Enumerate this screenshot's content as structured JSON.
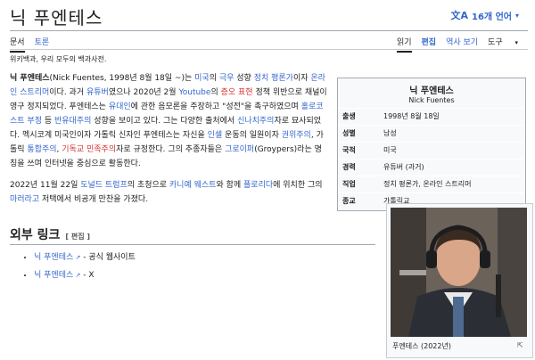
{
  "page": {
    "title": "닉 푸엔테스",
    "lang_button": "16개 언어",
    "lang_icon": "文A",
    "tagline": "위키백과, 우리 모두의 백과사전."
  },
  "tabs_left": [
    "문서",
    "토론"
  ],
  "tabs_right": [
    "읽기",
    "편집",
    "역사 보기",
    "도구"
  ],
  "lead": {
    "p1": [
      {
        "t": "닉 푸엔테스",
        "b": true
      },
      {
        "t": "(Nick Fuentes, 1998년 8월 18일 ~)는 "
      },
      {
        "t": "미국",
        "l": true
      },
      {
        "t": "의 "
      },
      {
        "t": "극우",
        "l": true
      },
      {
        "t": " 성향 "
      },
      {
        "t": "정치 평론가",
        "l": true
      },
      {
        "t": "이자 "
      },
      {
        "t": "온라인 스트리머",
        "l": true
      },
      {
        "t": "이다. 과거 "
      },
      {
        "t": "유튜버",
        "l": true
      },
      {
        "t": "였으나 2020년 2월 "
      },
      {
        "t": "Youtube",
        "l": true
      },
      {
        "t": "의 "
      },
      {
        "t": "증오 표현",
        "r": true
      },
      {
        "t": " 정책 위반으로 채널이 영구 정지되었다. 푸엔테스는 "
      },
      {
        "t": "유대인",
        "l": true
      },
      {
        "t": "에 관한 음모론을 주장하고 \"성전\"을 촉구하였으며 "
      },
      {
        "t": "홀로코스트 부정",
        "l": true
      },
      {
        "t": " 등 "
      },
      {
        "t": "반유대주의",
        "l": true
      },
      {
        "t": " 성향을 보이고 있다. 그는 다양한 출처에서 "
      },
      {
        "t": "신나치주의",
        "l": true
      },
      {
        "t": "자로 묘사되었다. 멕시코계 미국인이자 가톨릭 신자인 푸엔테스는 자신을 "
      },
      {
        "t": "인셀",
        "l": true
      },
      {
        "t": " 운동의 일원이자 "
      },
      {
        "t": "권위주의",
        "l": true
      },
      {
        "t": ", 가톨릭 "
      },
      {
        "t": "통합주의",
        "l": true
      },
      {
        "t": ", "
      },
      {
        "t": "기독교 민족주의",
        "r": true
      },
      {
        "t": "자로 규정한다. 그의 추종자들은 "
      },
      {
        "t": "그로이퍼",
        "l": true
      },
      {
        "t": "(Groypers)라는 명칭을 쓰며 인터넷을 중심으로 활동한다."
      }
    ],
    "p2": [
      {
        "t": "2022년 11월 22일 "
      },
      {
        "t": "도널드 트럼프",
        "l": true
      },
      {
        "t": "의 초청으로 "
      },
      {
        "t": "카니예 웨스트",
        "l": true
      },
      {
        "t": "와 함께 "
      },
      {
        "t": "플로리다",
        "l": true
      },
      {
        "t": "에 위치한 그의 "
      },
      {
        "t": "마러라고",
        "l": true
      },
      {
        "t": " 저택에서 비공개 만찬을 가졌다."
      }
    ]
  },
  "infobox": {
    "title": "닉 푸엔테스",
    "subtitle": "Nick Fuentes",
    "rows": [
      {
        "k": "출생",
        "v": "1998년 8월 18일"
      },
      {
        "k": "성별",
        "v": "남성"
      },
      {
        "k": "국적",
        "v": "미국"
      },
      {
        "k": "경력",
        "v": "유튜버 (과거)"
      },
      {
        "k": "직업",
        "v": "정치 평론가, 온라인 스트리머"
      },
      {
        "k": "종교",
        "v": "가톨릭교"
      }
    ]
  },
  "external": {
    "heading": "외부 링크",
    "edit": "[ 편집 ]",
    "items": [
      {
        "link": "닉 푸엔테스",
        "suffix": " - 공식 웹사이트"
      },
      {
        "link": "닉 푸엔테스",
        "suffix": " - X"
      }
    ]
  },
  "photo": {
    "caption": "푸엔테스 (2022년)"
  },
  "colors": {
    "link": "#3366cc",
    "redlink": "#d73333",
    "text": "#202122"
  }
}
